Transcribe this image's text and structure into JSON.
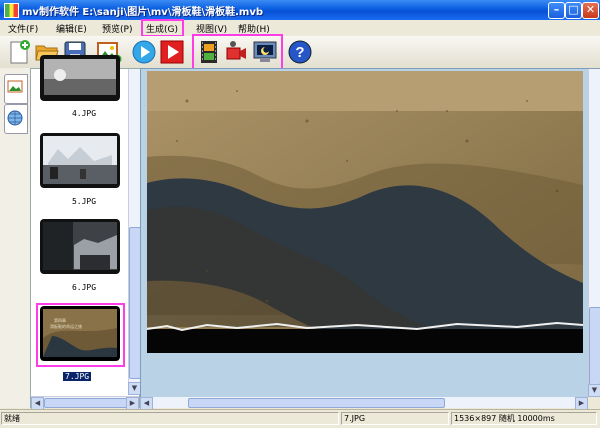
{
  "window": {
    "title": "mv制作软件 E:\\sanji\\图片\\mv\\滑板鞋\\滑板鞋.mvb",
    "min": "–",
    "max": "□",
    "close": "✕"
  },
  "menu": [
    {
      "label": "文件(F)"
    },
    {
      "label": "编辑(E)"
    },
    {
      "label": "预览(P)"
    },
    {
      "label": "生成(G)"
    },
    {
      "label": "视图(V)"
    },
    {
      "label": "帮助(H)"
    }
  ],
  "toolbar": [
    "new-file-icon",
    "open-folder-icon",
    "save-icon",
    "add-image-icon",
    "play-icon",
    "play-red-icon",
    "film-icon",
    "record-icon",
    "monitor-icon",
    "help-icon"
  ],
  "thumbnails": [
    {
      "label": "4.JPG"
    },
    {
      "label": "5.JPG"
    },
    {
      "label": "6.JPG"
    },
    {
      "label": "7.JPG",
      "selected": true,
      "caption": "第四章\n滑板鞋的命运之旅"
    }
  ],
  "status": {
    "ready": "就绪",
    "file": "7.JPG",
    "info": "1536×897 随机 10000ms"
  },
  "colors": {
    "highlight": "#ff3ce6",
    "titlebar": "#0a5fe0",
    "preview_bg": "#b9d2e6"
  }
}
